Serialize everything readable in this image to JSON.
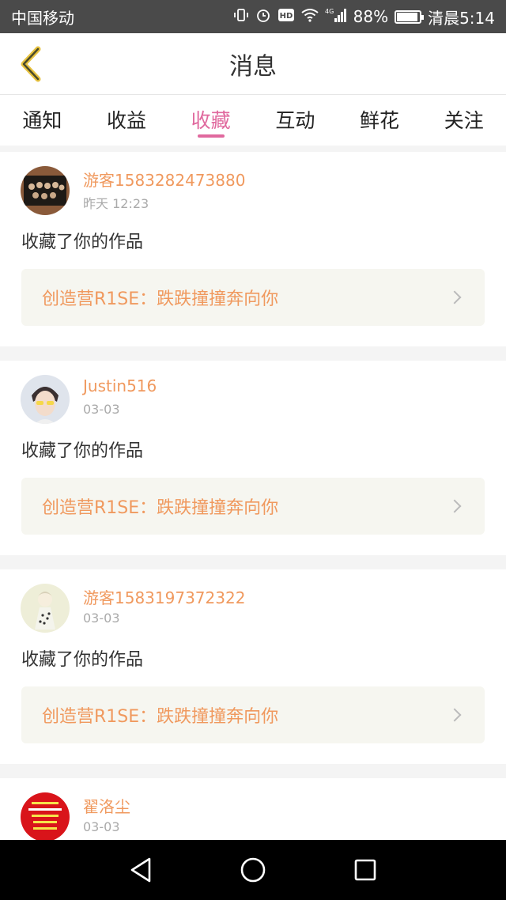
{
  "status_bar": {
    "carrier": "中国移动",
    "network": "4G",
    "battery": "88%",
    "battery_level": 0.88,
    "time": "清晨5:14",
    "icons": [
      "vibrate-icon",
      "alarm-icon",
      "hd-icon",
      "wifi-icon",
      "signal-icon",
      "battery-icon"
    ]
  },
  "header": {
    "back_icon": "chevron-left-icon",
    "title": "消息"
  },
  "tabs": [
    {
      "label": "通知"
    },
    {
      "label": "收益"
    },
    {
      "label": "收藏",
      "active": true
    },
    {
      "label": "互动"
    },
    {
      "label": "鲜花"
    },
    {
      "label": "关注"
    }
  ],
  "notifications": [
    {
      "username": "游客1583282473880",
      "time": "昨天 12:23",
      "action": "收藏了你的作品",
      "work_title": "创造营R1SE：跌跌撞撞奔向你"
    },
    {
      "username": "Justin516",
      "time": "03-03",
      "action": "收藏了你的作品",
      "work_title": "创造营R1SE：跌跌撞撞奔向你"
    },
    {
      "username": "游客1583197372322",
      "time": "03-03",
      "action": "收藏了你的作品",
      "work_title": "创造营R1SE：跌跌撞撞奔向你"
    },
    {
      "username": "翟洛尘",
      "time": "03-03"
    }
  ],
  "nav": {
    "icons": [
      "back-triangle-icon",
      "home-circle-icon",
      "recent-square-icon"
    ]
  },
  "colors": {
    "accent": "#e0699e",
    "username": "#f0995e",
    "status_bar": "#4a4a4a",
    "back_arrow": "#e7c23f"
  }
}
